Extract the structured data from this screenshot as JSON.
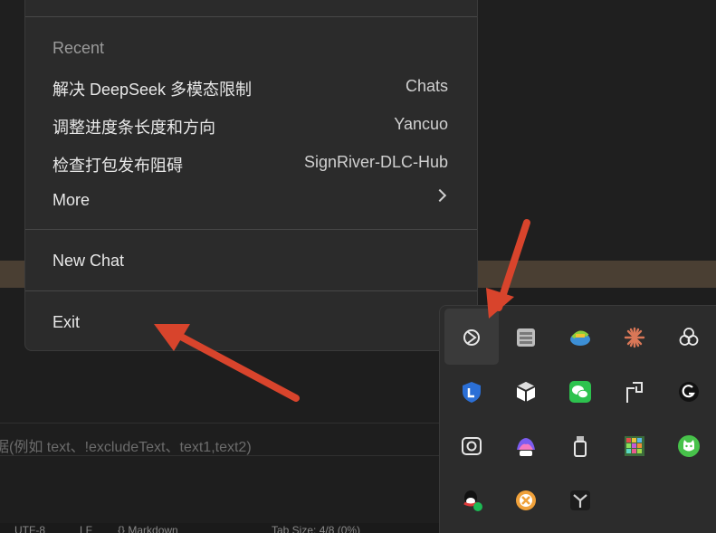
{
  "menu": {
    "recent_header": "Recent",
    "recent_items": [
      {
        "title": "解决 DeepSeek 多模态限制",
        "project": "Chats"
      },
      {
        "title": "调整进度条长度和方向",
        "project": "Yancuo"
      },
      {
        "title": "检查打包发布阻碍",
        "project": "SignRiver-DLC-Hub"
      }
    ],
    "more_label": "More",
    "new_chat_label": "New Chat",
    "exit_label": "Exit"
  },
  "background": {
    "filter_placeholder": "据(例如 text、!excludeText、text1,text2)",
    "status_items": [
      "UTF-8",
      "LF",
      "{} Markdown",
      "Tab Size: 4/8 (0%)"
    ]
  },
  "tray": {
    "icons": [
      "chatgpt-icon",
      "virtual-machine-icon",
      "internet-download-icon",
      "claude-icon",
      "openai-icon",
      "shield-security-icon",
      "cube-icon",
      "wechat-icon",
      "pdf-tool-icon",
      "logitech-icon",
      "screen-capture-icon",
      "microsoft-365-icon",
      "usb-drive-icon",
      "colorful-grid-icon",
      "cat-app-icon",
      "qq-icon",
      "cancel-circle-icon",
      "unity-hub-icon"
    ]
  },
  "colors": {
    "arrow": "#d8442c",
    "menu_bg": "#2b2b2b",
    "tray_bg": "#2c2c2c"
  }
}
